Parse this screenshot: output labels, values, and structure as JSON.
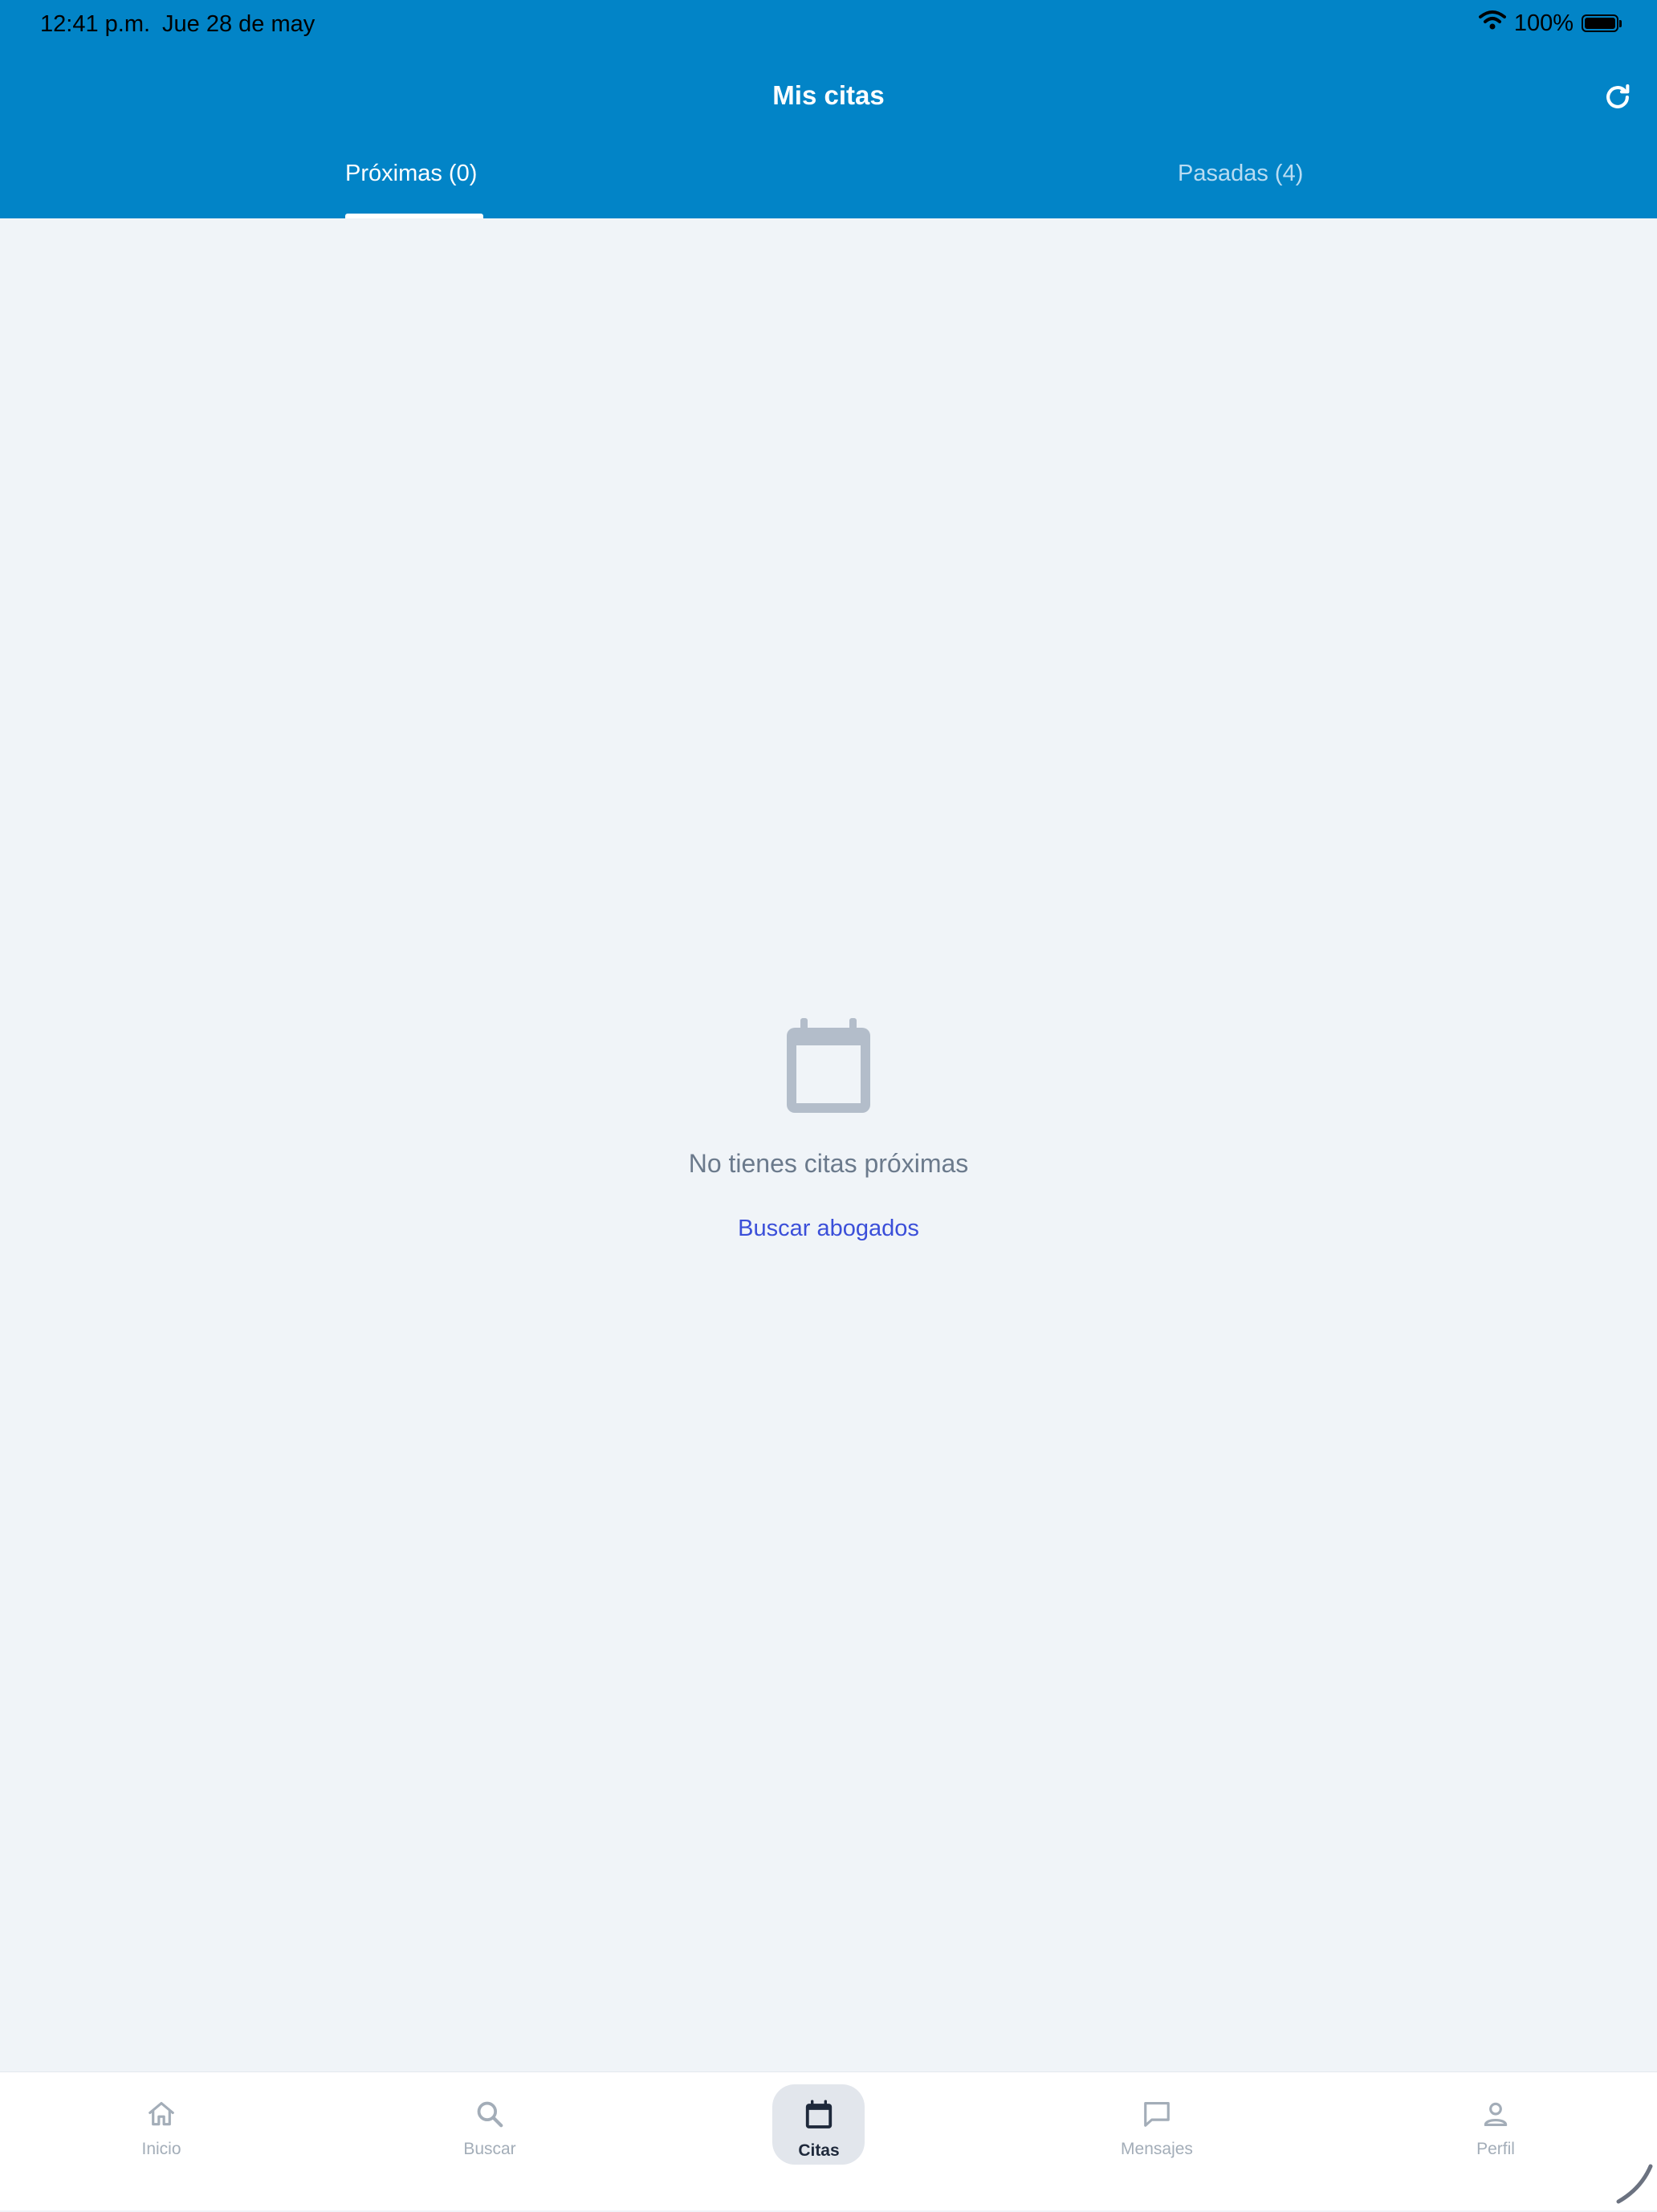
{
  "status_bar": {
    "time": "12:41 p.m.",
    "date": "Jue 28 de may",
    "battery": "100%",
    "icons": [
      "wifi-icon",
      "battery-icon"
    ]
  },
  "header": {
    "title": "Mis citas",
    "refresh_icon": "refresh-icon",
    "background_color": "#0284c7"
  },
  "tabs": [
    {
      "label": "Próximas (0)",
      "active": true
    },
    {
      "label": "Pasadas (4)",
      "active": false
    }
  ],
  "empty_state": {
    "icon": "calendar-icon",
    "message": "No tienes citas próximas",
    "action_label": "Buscar abogados"
  },
  "bottom_nav": {
    "items": [
      {
        "label": "Inicio",
        "icon": "home-icon",
        "active": false
      },
      {
        "label": "Buscar",
        "icon": "search-icon",
        "active": false
      },
      {
        "label": "Citas",
        "icon": "calendar-icon",
        "active": true
      },
      {
        "label": "Mensajes",
        "icon": "chat-icon",
        "active": false
      },
      {
        "label": "Perfil",
        "icon": "person-icon",
        "active": false
      }
    ]
  },
  "colors": {
    "accent": "#0284c7",
    "link": "#3b4fd9",
    "background": "#f0f4f8"
  }
}
